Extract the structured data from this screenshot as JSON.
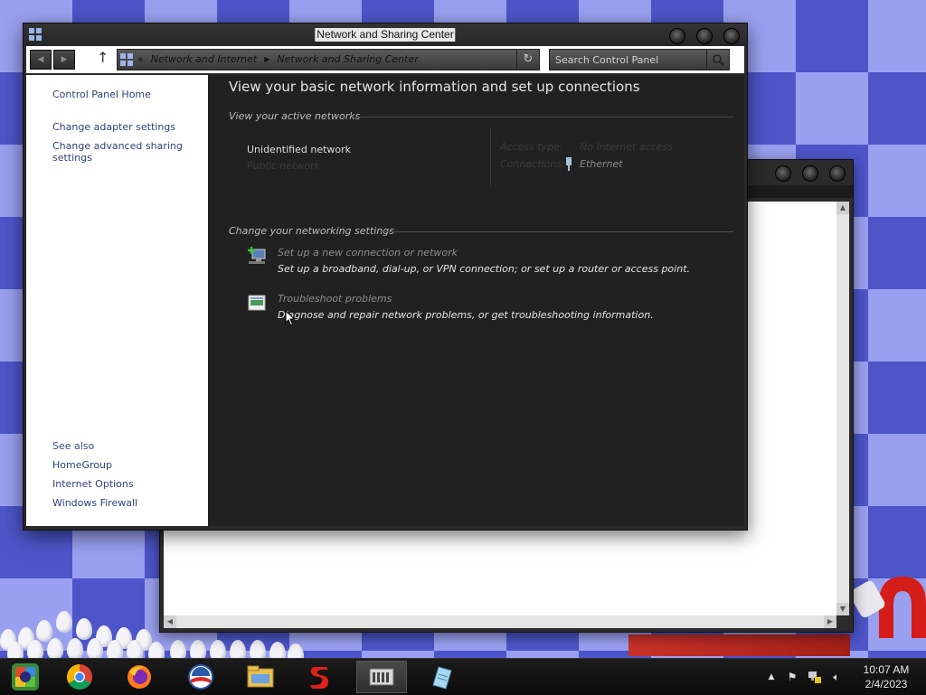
{
  "window": {
    "title": "Network and Sharing Center"
  },
  "navigation": {
    "breadcrumb_prefix": "«",
    "breadcrumbs": [
      "Network and Internet",
      "Network and Sharing Center"
    ],
    "search_placeholder": "Search Control Panel"
  },
  "sidebar": {
    "home": "Control Panel Home",
    "links": [
      "Change adapter settings",
      "Change advanced sharing settings"
    ],
    "see_also_heading": "See also",
    "see_also": [
      "HomeGroup",
      "Internet Options",
      "Windows Firewall"
    ]
  },
  "main": {
    "heading": "View your basic network information and set up connections",
    "active_networks_heading": "View your active networks",
    "network": {
      "name": "Unidentified network",
      "type": "Public network",
      "access_type_label": "Access type:",
      "access_type_value": "No Internet access",
      "connections_label": "Connections:",
      "connections_value": "Ethernet"
    },
    "settings_heading": "Change your networking settings",
    "tasks": [
      {
        "title": "Set up a new connection or network",
        "description": "Set up a broadband, dial-up, or VPN connection; or set up a router or access point."
      },
      {
        "title": "Troubleshoot problems",
        "description": "Diagnose and repair network problems, or get troubleshooting information."
      }
    ]
  },
  "taskbar": {
    "apps": [
      "start-orb-icon",
      "chrome-icon",
      "firefox-icon",
      "obama-logo-icon",
      "file-explorer-icon",
      "s-logo-icon",
      "control-panel-icon",
      "notepad-icon"
    ],
    "clock_time": "10:07 AM",
    "clock_date": "2/4/2023"
  }
}
